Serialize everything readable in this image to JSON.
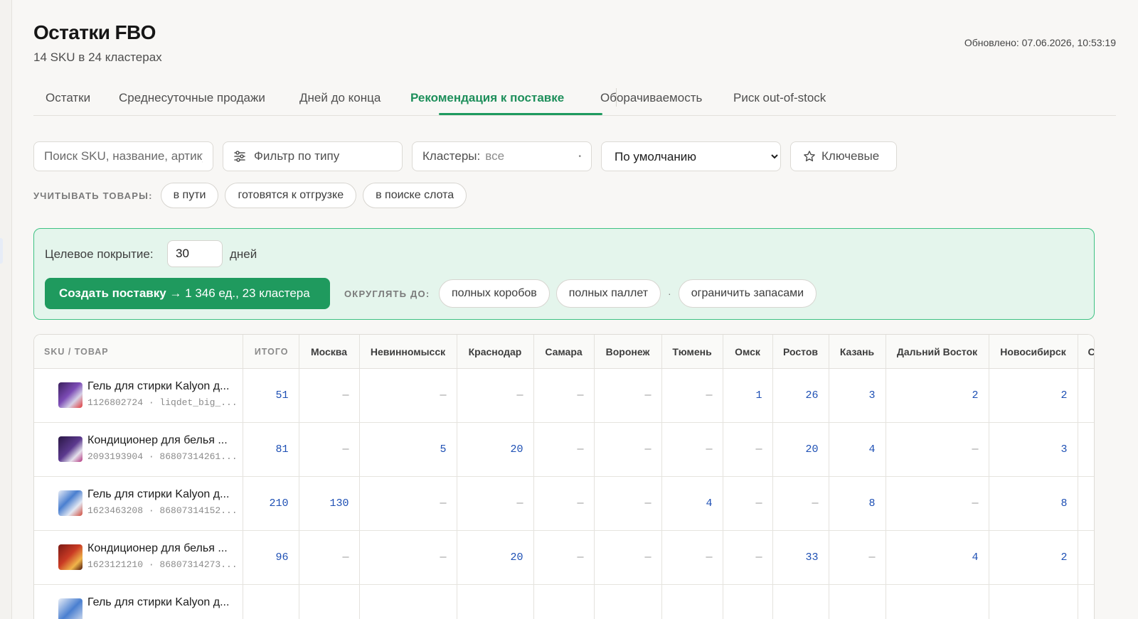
{
  "header": {
    "title": "Остатки FBO",
    "subtitle": "14 SKU в 24 кластерах",
    "updated": "Обновлено: 07.06.2026, 10:53:19"
  },
  "tabs": [
    {
      "label": "Остатки"
    },
    {
      "label": "Среднесуточные продажи"
    },
    {
      "label": "Дней до конца"
    },
    {
      "label": "Рекомендация к поставке",
      "active": true
    },
    {
      "label": "Оборачиваемость"
    },
    {
      "label": "Риск out-of-stock"
    }
  ],
  "filters": {
    "search_placeholder": "Поиск SKU, название, артикул",
    "type_filter": "Фильтр по типу",
    "clusters_label": "Кластеры:",
    "clusters_value": "все",
    "sort_selected": "По умолчанию",
    "key_label": "Ключевые"
  },
  "include": {
    "label": "УЧИТЫВАТЬ ТОВАРЫ:",
    "chips": [
      "в пути",
      "готовятся к отгрузке",
      "в поиске слота"
    ]
  },
  "plan": {
    "coverage_label": "Целевое покрытие:",
    "coverage_value": "30",
    "days_label": "дней",
    "create_label": "Создать поставку →",
    "create_summary": "1 346 ед., 23 кластера",
    "round_label": "ОКРУГЛЯТЬ ДО:",
    "round_chips": [
      "полных коробов",
      "полных паллет"
    ],
    "limit_chip": "ограничить запасами"
  },
  "table": {
    "sku_header": "SKU / ТОВАР",
    "total_header": "ИТОГО",
    "columns": [
      "Москва",
      "Невинномысск",
      "Краснодар",
      "Самара",
      "Воронеж",
      "Тюмень",
      "Омск",
      "Ростов",
      "Казань",
      "Дальний Восток",
      "Новосибирск",
      "С"
    ],
    "rows": [
      {
        "name": "Гель для стирки Kalyon д...",
        "meta": "1126802724 · liqdet_big_...",
        "total": "51",
        "cells": [
          "—",
          "—",
          "—",
          "—",
          "—",
          "—",
          "1",
          "26",
          "3",
          "2",
          "2",
          ""
        ]
      },
      {
        "name": "Кондиционер для белья ...",
        "meta": "2093193904 · 86807314261...",
        "total": "81",
        "cells": [
          "—",
          "5",
          "20",
          "—",
          "—",
          "—",
          "—",
          "20",
          "4",
          "—",
          "3",
          ""
        ]
      },
      {
        "name": "Гель для стирки Kalyon д...",
        "meta": "1623463208 · 86807314152...",
        "total": "210",
        "cells": [
          "130",
          "—",
          "—",
          "—",
          "—",
          "4",
          "—",
          "—",
          "8",
          "—",
          "8",
          ""
        ]
      },
      {
        "name": "Кондиционер для белья ...",
        "meta": "1623121210 · 86807314273...",
        "total": "96",
        "cells": [
          "—",
          "—",
          "20",
          "—",
          "—",
          "—",
          "—",
          "33",
          "—",
          "4",
          "2",
          ""
        ]
      },
      {
        "name": "Гель для стирки Kalyon д...",
        "meta": "",
        "total": "",
        "cells": [
          "",
          "",
          "",
          "",
          "",
          "",
          "",
          "",
          "",
          "",
          "",
          ""
        ]
      }
    ]
  },
  "colors": {
    "accent": "#1e9a5f",
    "plan_bg": "#e4f5ec",
    "number": "#1d4fb4"
  }
}
